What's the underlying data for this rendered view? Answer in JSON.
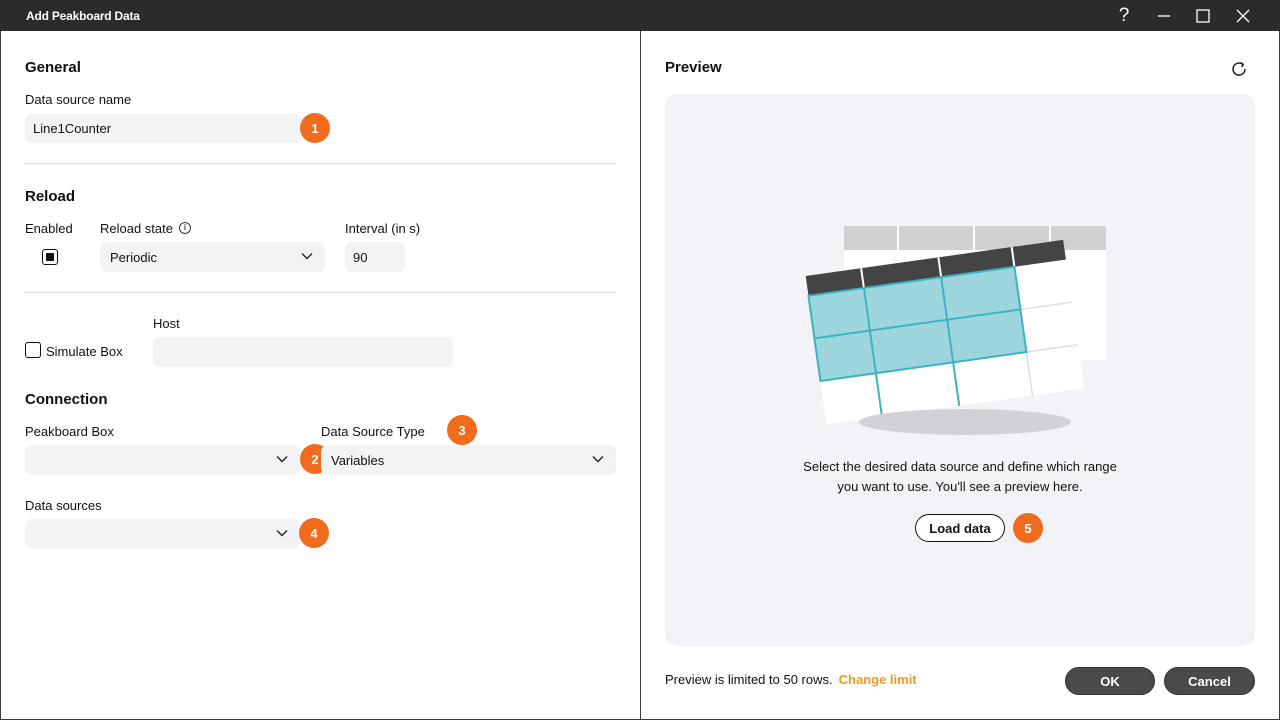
{
  "window": {
    "title": "Add Peakboard Data",
    "help_glyph": "?"
  },
  "general": {
    "section_title": "General",
    "name_label": "Data source name",
    "name_value": "Line1Counter",
    "badge": "1"
  },
  "reload": {
    "section_title": "Reload",
    "enabled_label": "Enabled",
    "enabled_checked": true,
    "state_label": "Reload state",
    "state_value": "Periodic",
    "interval_label": "Interval (in s)",
    "interval_value": "90"
  },
  "simulate": {
    "checkbox_label": "Simulate Box",
    "checked": false,
    "host_label": "Host",
    "host_value": ""
  },
  "connection": {
    "section_title": "Connection",
    "box_label": "Peakboard Box",
    "box_value": "",
    "box_badge": "2",
    "type_label": "Data Source Type",
    "type_value": "Variables",
    "type_badge": "3",
    "sources_label": "Data sources",
    "sources_value": "",
    "sources_badge": "4"
  },
  "preview": {
    "title": "Preview",
    "message_line1": "Select the desired data source and define which range",
    "message_line2": "you want to use. You'll see a preview here.",
    "load_button": "Load data",
    "load_badge": "5",
    "limit_text": "Preview is limited to 50 rows.",
    "change_limit": "Change limit"
  },
  "footer": {
    "ok": "OK",
    "cancel": "Cancel"
  },
  "colors": {
    "accent_badge": "#f26b1d",
    "link": "#f39a1e",
    "titlebar": "#2b2b2b",
    "table_cell": "#9dd5dc",
    "table_border": "#3ab3c4"
  }
}
